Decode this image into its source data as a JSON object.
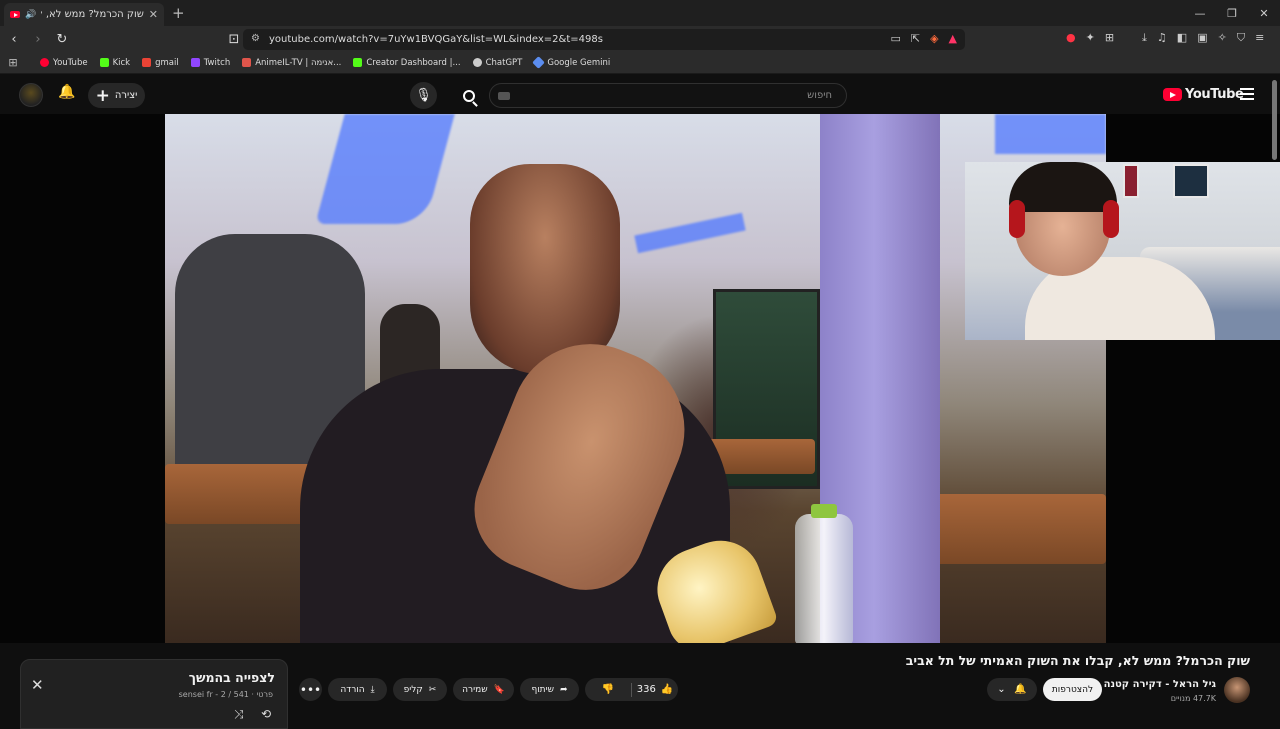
{
  "browser": {
    "tab_title": "שוק הכרמל? ממש לא, קבלו א",
    "url": "youtube.com/watch?v=7uYw1BVQGaY&list=WL&index=2&t=498s",
    "window_controls": [
      "—",
      "❐",
      "✕"
    ]
  },
  "bookmarks": [
    {
      "label": "YouTube",
      "color": "#ff0033"
    },
    {
      "label": "Kick",
      "color": "#53fc18"
    },
    {
      "label": "gmail",
      "color": "#ea4335"
    },
    {
      "label": "Twitch",
      "color": "#9146ff"
    },
    {
      "label": "AnimeIL-TV | אנימה...",
      "color": "#e0554b"
    },
    {
      "label": "Creator Dashboard |...",
      "color": "#53fc18"
    },
    {
      "label": "ChatGPT",
      "color": "#cccccc"
    },
    {
      "label": "Google Gemini",
      "color": "#5b8def"
    }
  ],
  "youtube": {
    "logo_text": "YouTube",
    "search_placeholder": "חיפוש",
    "create_label": "יצירה"
  },
  "video": {
    "title": "שוק הכרמל? ממש לא, קבלו את השוק האמיתי של תל אביב",
    "channel_name": "גיל הראל - דקירה קטנה",
    "subscribers": "47.7K מנויים",
    "join_label": "להצטרפות",
    "like_count": "336",
    "share_label": "שיתוף",
    "save_label": "שמירה",
    "clip_label": "קליפ",
    "download_label": "הורדה"
  },
  "playlist": {
    "title": "לצפייה בהמשך",
    "subtitle": "פרטי · sensei fr - 2 / 541"
  }
}
